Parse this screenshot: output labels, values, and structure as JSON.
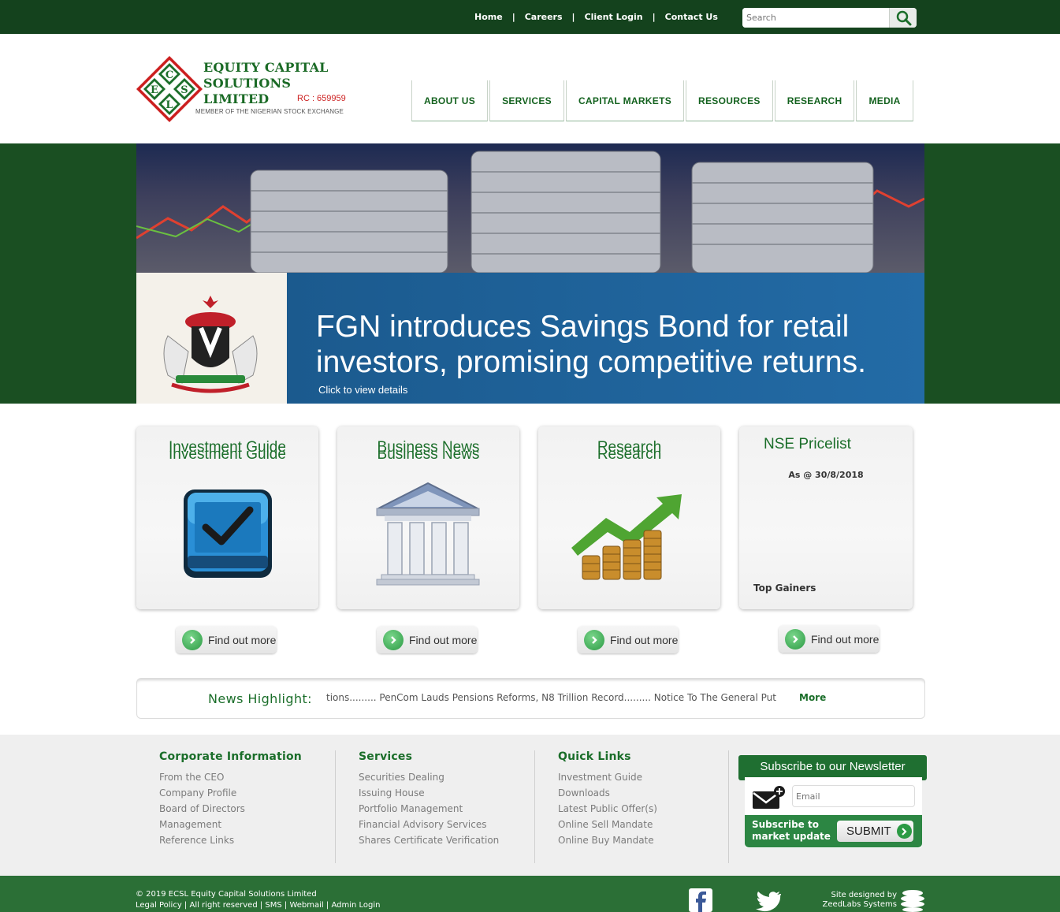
{
  "topnav": {
    "links": [
      "Home",
      "Careers",
      "Client Login",
      "Contact Us"
    ],
    "search_placeholder": "Search"
  },
  "logo": {
    "monogram": [
      "C",
      "E",
      "S",
      "L"
    ],
    "name_line1": "EQUITY CAPITAL",
    "name_line2": "SOLUTIONS LIMITED",
    "rc": "RC : 659959",
    "member": "MEMBER OF THE NIGERIAN STOCK EXCHANGE"
  },
  "mainnav": [
    "ABOUT US",
    "SERVICES",
    "CAPITAL MARKETS",
    "RESOURCES",
    "RESEARCH",
    "MEDIA"
  ],
  "hero": {
    "headline_line1": "FGN introduces Savings Bond for retail",
    "headline_line2": "investors, promising competitive returns.",
    "cta": "Click to view details"
  },
  "cards": [
    {
      "title": "Investment Guide",
      "button": "Find out more"
    },
    {
      "title": "Business News",
      "button": "Find out more"
    },
    {
      "title": "Research",
      "button": "Find out more"
    },
    {
      "title": "NSE Pricelist",
      "date": "As @ 30/8/2018",
      "subtitle": "Top Gainers",
      "button": "Find out more"
    }
  ],
  "news": {
    "label": "News Highlight:",
    "ticker": "tions......... PenCom Lauds Pensions Reforms, N8 Trillion Record......... Notice To The General Put",
    "more": "More"
  },
  "footer": {
    "columns": [
      {
        "heading": "Corporate Information",
        "links": [
          "From the CEO",
          "Company Profile",
          "Board of Directors",
          "Management",
          "Reference Links"
        ]
      },
      {
        "heading": "Services",
        "links": [
          "Securities Dealing",
          "Issuing House",
          "Portfolio Management",
          "Financial Advisory Services",
          "Shares Certificate Verification"
        ]
      },
      {
        "heading": "Quick Links",
        "links": [
          "Investment Guide",
          "Downloads",
          "Latest Public Offer(s)",
          "Online Sell Mandate",
          "Online Buy Mandate"
        ]
      }
    ],
    "newsletter": {
      "heading": "Subscribe to our Newsletter",
      "email_placeholder": "Email",
      "subscribe_line1": "Subscribe to",
      "subscribe_line2": "market update",
      "submit": "SUBMIT"
    }
  },
  "bottom": {
    "copyright": "© 2019 ECSL Equity Capital Solutions Limited",
    "links": [
      "Legal Policy",
      "All right reserved",
      "SMS",
      "Webmail",
      "Admin Login"
    ],
    "designed_line1": "Site designed by",
    "designed_line2": "ZeedLabs Systems"
  },
  "colors": {
    "brand_green": "#1b6e2a",
    "topbar": "#14421d",
    "logo_red": "#cc1f1f",
    "hero_blue": "#236ba6"
  }
}
